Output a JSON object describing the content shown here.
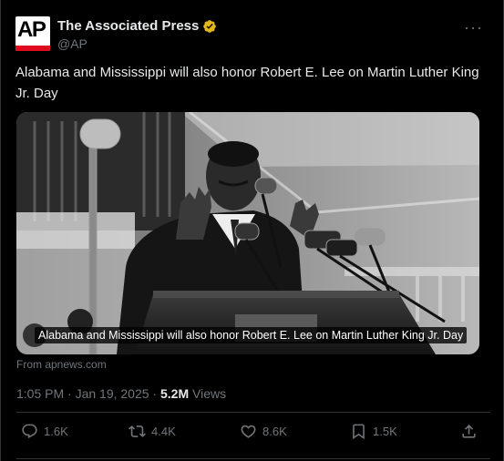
{
  "author": {
    "display_name": "The Associated Press",
    "handle": "@AP",
    "avatar_text": "AP",
    "verified_badge": "gold-verified-icon"
  },
  "post": {
    "text": "Alabama and Mississippi will also honor Robert E. Lee on Martin Luther King Jr. Day",
    "media_caption": "Alabama and Mississippi will also honor Robert E. Lee on Martin Luther King Jr. Day",
    "source": "From apnews.com",
    "timestamp": "1:05 PM · Jan 19, 2025 · ",
    "views_count": "5.2M",
    "views_label": " Views"
  },
  "more_label": "···",
  "actions": {
    "replies": "1.6K",
    "reposts": "4.4K",
    "likes": "8.6K",
    "bookmarks": "1.5K"
  },
  "colors": {
    "background": "#000000",
    "text": "#e7e9ea",
    "secondary": "#71767b",
    "divider": "#2f3336",
    "verified": "#e2b719",
    "ap_red": "#e10b1f"
  }
}
